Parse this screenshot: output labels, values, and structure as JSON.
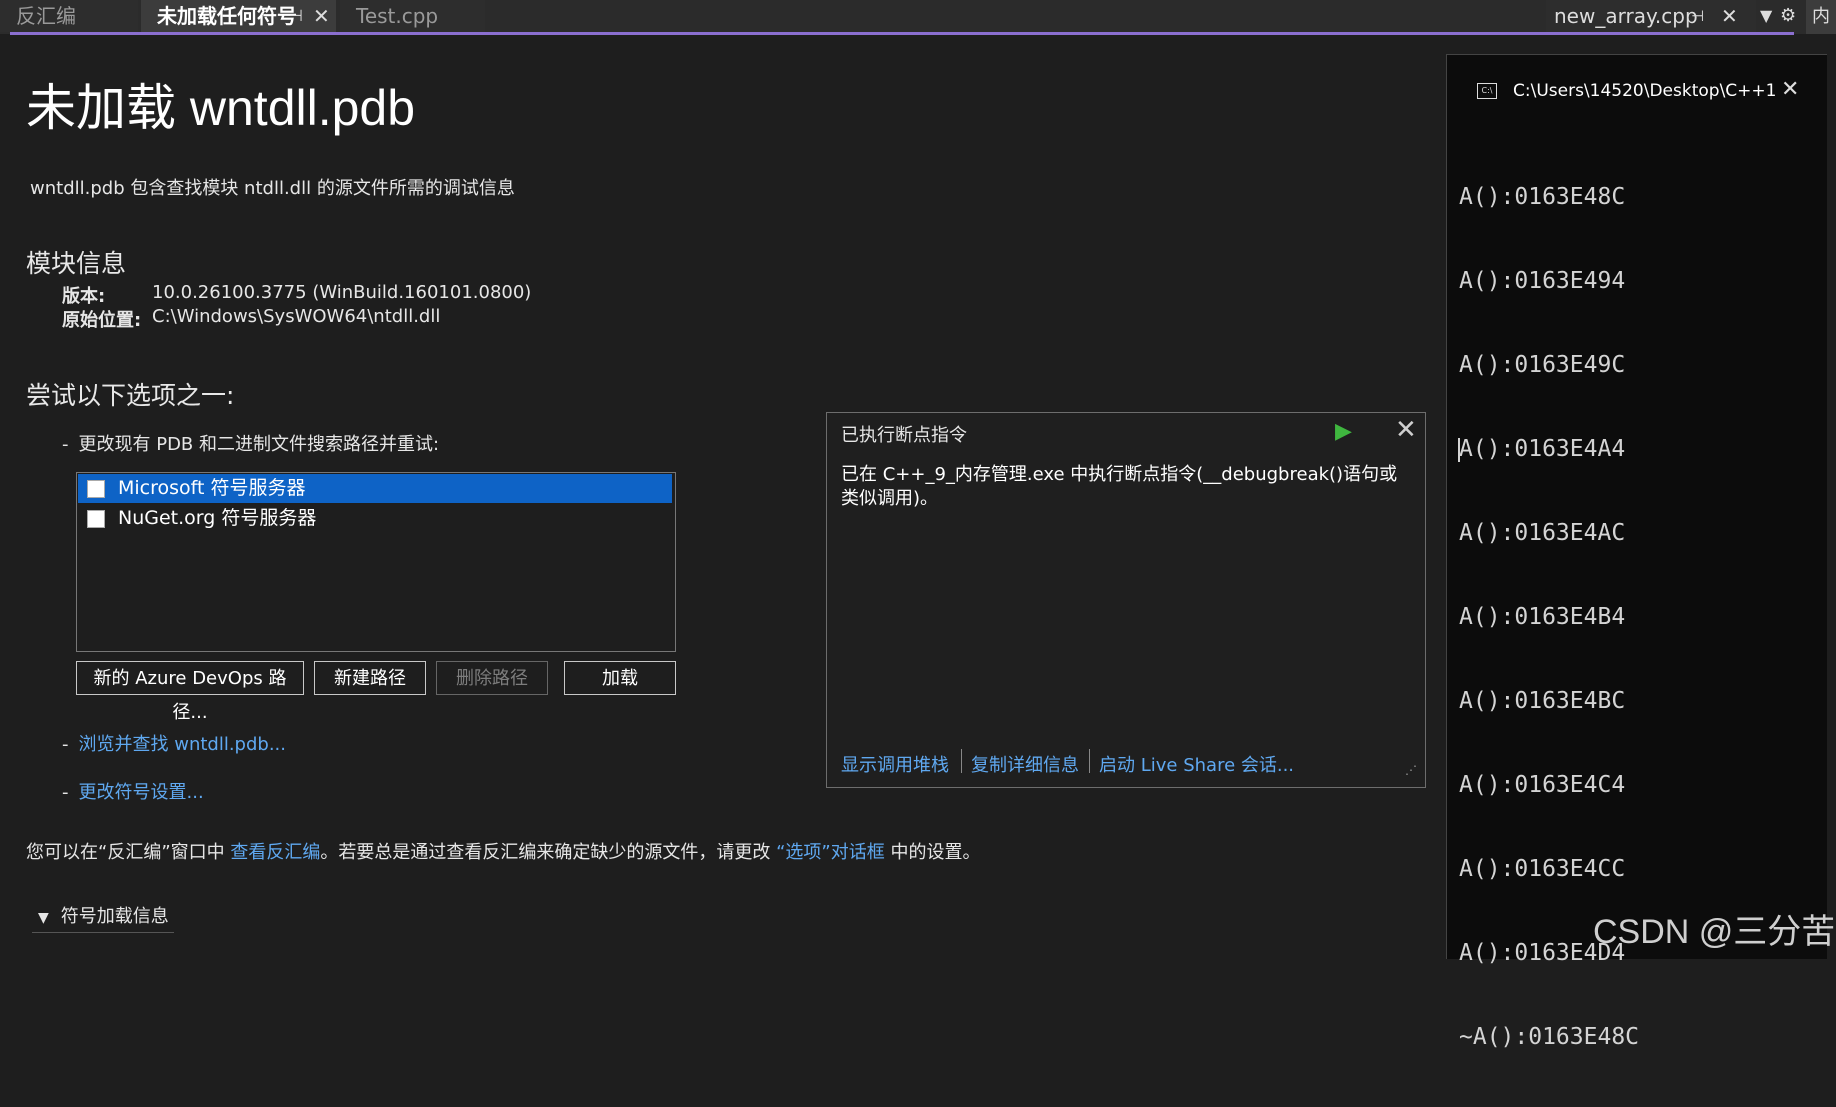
{
  "tabs": [
    {
      "label": "反汇编"
    },
    {
      "label": "未加载任何符号"
    },
    {
      "label": "Test.cpp"
    }
  ],
  "right_tab": {
    "label": "new_array.cpp"
  },
  "edge_tab": {
    "label": "内"
  },
  "page": {
    "title": "未加载 wntdll.pdb",
    "description": "wntdll.pdb 包含查找模块 ntdll.dll 的源文件所需的调试信息",
    "module_heading": "模块信息",
    "version_label": "版本:",
    "version_value": "10.0.26100.3775 (WinBuild.160101.0800)",
    "location_label": "原始位置:",
    "location_value": "C:\\Windows\\SysWOW64\\ntdll.dll",
    "options_heading": "尝试以下选项之一:",
    "option1": "更改现有 PDB 和二进制文件搜索路径并重试:",
    "servers": [
      "Microsoft 符号服务器",
      "NuGet.org 符号服务器"
    ],
    "buttons": {
      "azure": "新的 Azure DevOps 路径...",
      "new_path": "新建路径",
      "delete_path": "删除路径",
      "load": "加载"
    },
    "browse_link": "浏览并查找 wntdll.pdb...",
    "settings_link": "更改符号设置...",
    "footer_prefix": "您可以在“反汇编”窗口中 ",
    "footer_link1": "查看反汇编",
    "footer_middle": "。若要总是通过查看反汇编来确定缺少的源文件，请更改 ",
    "footer_link2": "“选项”对话框",
    "footer_suffix": " 中的设置。",
    "expander": "符号加载信息"
  },
  "popup": {
    "title": "已执行断点指令",
    "message": "已在 C++_9_内存管理.exe 中执行断点指令(__debugbreak()语句或类似调用)。",
    "actions": [
      "显示调用堆栈",
      "复制详细信息",
      "启动 Live Share 会话..."
    ]
  },
  "console": {
    "title": "C:\\Users\\14520\\Desktop\\C++1",
    "lines": [
      "A():0163E48C",
      "A():0163E494",
      "A():0163E49C",
      "A():0163E4A4",
      "A():0163E4AC",
      "A():0163E4B4",
      "A():0163E4BC",
      "A():0163E4C4",
      "A():0163E4CC",
      "A():0163E4D4",
      "~A():0163E48C"
    ]
  },
  "watermark": "CSDN @三分苦"
}
